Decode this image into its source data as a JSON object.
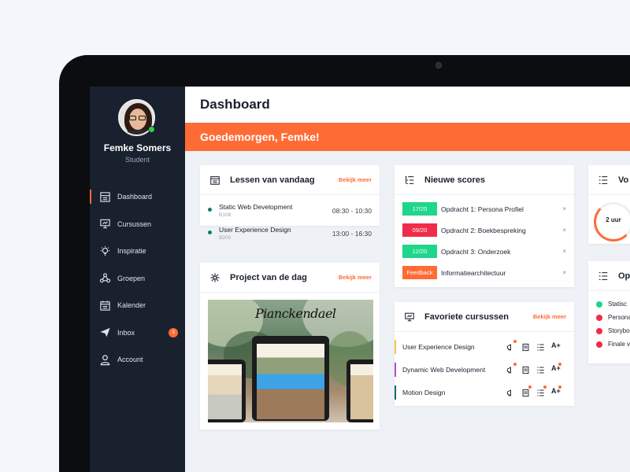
{
  "colors": {
    "accent": "#ff6b35",
    "sidebar": "#1a212e",
    "green": "#1fd68b",
    "red": "#ef2c49",
    "online": "#2bd24c"
  },
  "user": {
    "name": "Femke Somers",
    "role": "Student"
  },
  "sidebar": {
    "items": [
      {
        "label": "Dashboard",
        "icon": "dashboard-icon"
      },
      {
        "label": "Cursussen",
        "icon": "presentation-icon"
      },
      {
        "label": "Inspiratie",
        "icon": "lightbulb-icon"
      },
      {
        "label": "Groepen",
        "icon": "group-icon"
      },
      {
        "label": "Kalender",
        "icon": "calendar-icon"
      },
      {
        "label": "Inbox",
        "icon": "paper-plane-icon",
        "badge": "3"
      },
      {
        "label": "Account",
        "icon": "user-icon"
      }
    ]
  },
  "header": {
    "title": "Dashboard",
    "greeting": "Goedemorgen, Femke!"
  },
  "lessons": {
    "title": "Lessen van vandaag",
    "link": "Bekijk meer",
    "items": [
      {
        "name": "Static Web Development",
        "room": "B108",
        "time": "08:30 - 10:30"
      },
      {
        "name": "User Experience Design",
        "room": "B200",
        "time": "13:00 - 16:30"
      }
    ]
  },
  "project": {
    "title": "Project van de dag",
    "link": "Bekijk meer",
    "logo": "Pianckendael"
  },
  "scores": {
    "title": "Nieuwe scores",
    "items": [
      {
        "badge": "17/20",
        "status": "pass",
        "desc": "Opdracht 1: Persona Profiel"
      },
      {
        "badge": "09/20",
        "status": "fail",
        "desc": "Opdracht 2: Boekbespreking"
      },
      {
        "badge": "12/20",
        "status": "pass",
        "desc": "Opdracht 3: Onderzoek"
      },
      {
        "badge": "Feedback",
        "status": "feedback",
        "desc": "Informatiearchitectuur"
      }
    ],
    "close": "×"
  },
  "favorites": {
    "title": "Favoriete cursussen",
    "link": "Bekijk meer",
    "aplus": "A+",
    "items": [
      {
        "name": "User Experience Design",
        "color": "#f2c94c"
      },
      {
        "name": "Dynamic Web Development",
        "color": "#b14fc5"
      },
      {
        "name": "Motion Design",
        "color": "#0f6b63"
      }
    ]
  },
  "progress": {
    "title": "Vo",
    "hours": "2 uur"
  },
  "tasks": {
    "title": "Op",
    "items": [
      {
        "name": "Statisc",
        "status": "done"
      },
      {
        "name": "Persona",
        "status": "open"
      },
      {
        "name": "Storybo",
        "status": "open"
      },
      {
        "name": "Finale v",
        "status": "open"
      }
    ]
  }
}
